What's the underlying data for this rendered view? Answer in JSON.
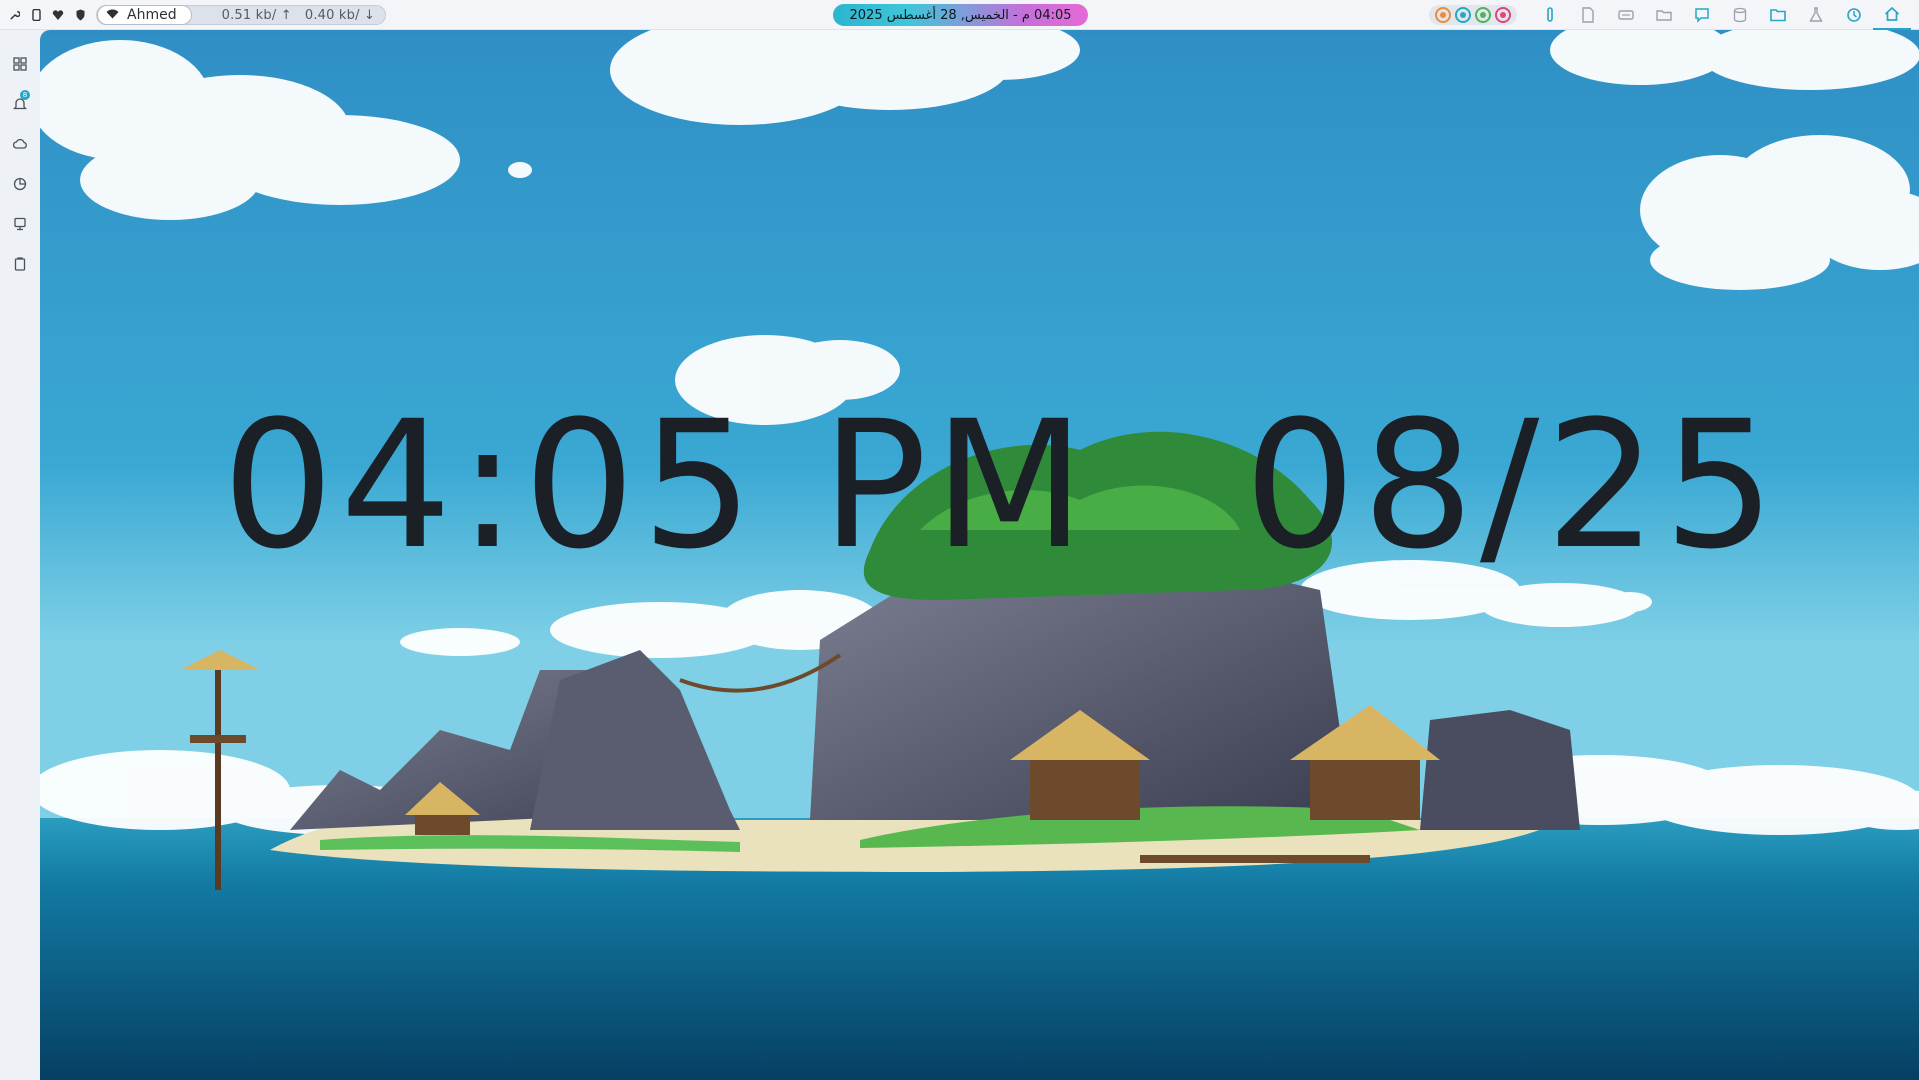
{
  "topbar": {
    "left_icons": [
      "wrench-icon",
      "phone-icon",
      "heart-icon",
      "shield-icon"
    ],
    "wifi_name": "Ahmed",
    "net_up": "0.51 kb/ ↑",
    "net_down": "0.40 kb/ ↓",
    "clock_text": "04:05 م - الخميس, 28 أغسطس 2025",
    "status_dots": [
      {
        "name": "mic-status-icon",
        "color": "#f08a3c"
      },
      {
        "name": "headphone-status-icon",
        "color": "#27a7c6"
      },
      {
        "name": "gamepad-status-icon",
        "color": "#4db35e"
      },
      {
        "name": "record-status-icon",
        "color": "#e0457b"
      }
    ],
    "apps": [
      "pin-app-icon",
      "document-app-icon",
      "keyboard-app-icon",
      "folder-outline-app-icon",
      "chat-app-icon",
      "database-app-icon",
      "folder-app-icon",
      "flask-app-icon",
      "refresh-app-icon",
      "home-app-icon"
    ]
  },
  "sidebar": {
    "items": [
      "grid-icon",
      "bell-icon",
      "cloud-icon",
      "chart-icon",
      "monitor-icon",
      "clipboard-icon"
    ],
    "notification_count": "8"
  },
  "desktop": {
    "time": "04:05 PM",
    "date": "08/25",
    "colors": {
      "sky_top": "#2f8fc5",
      "sky_bottom": "#7fd0e6",
      "sea": "#0e5f86"
    }
  }
}
